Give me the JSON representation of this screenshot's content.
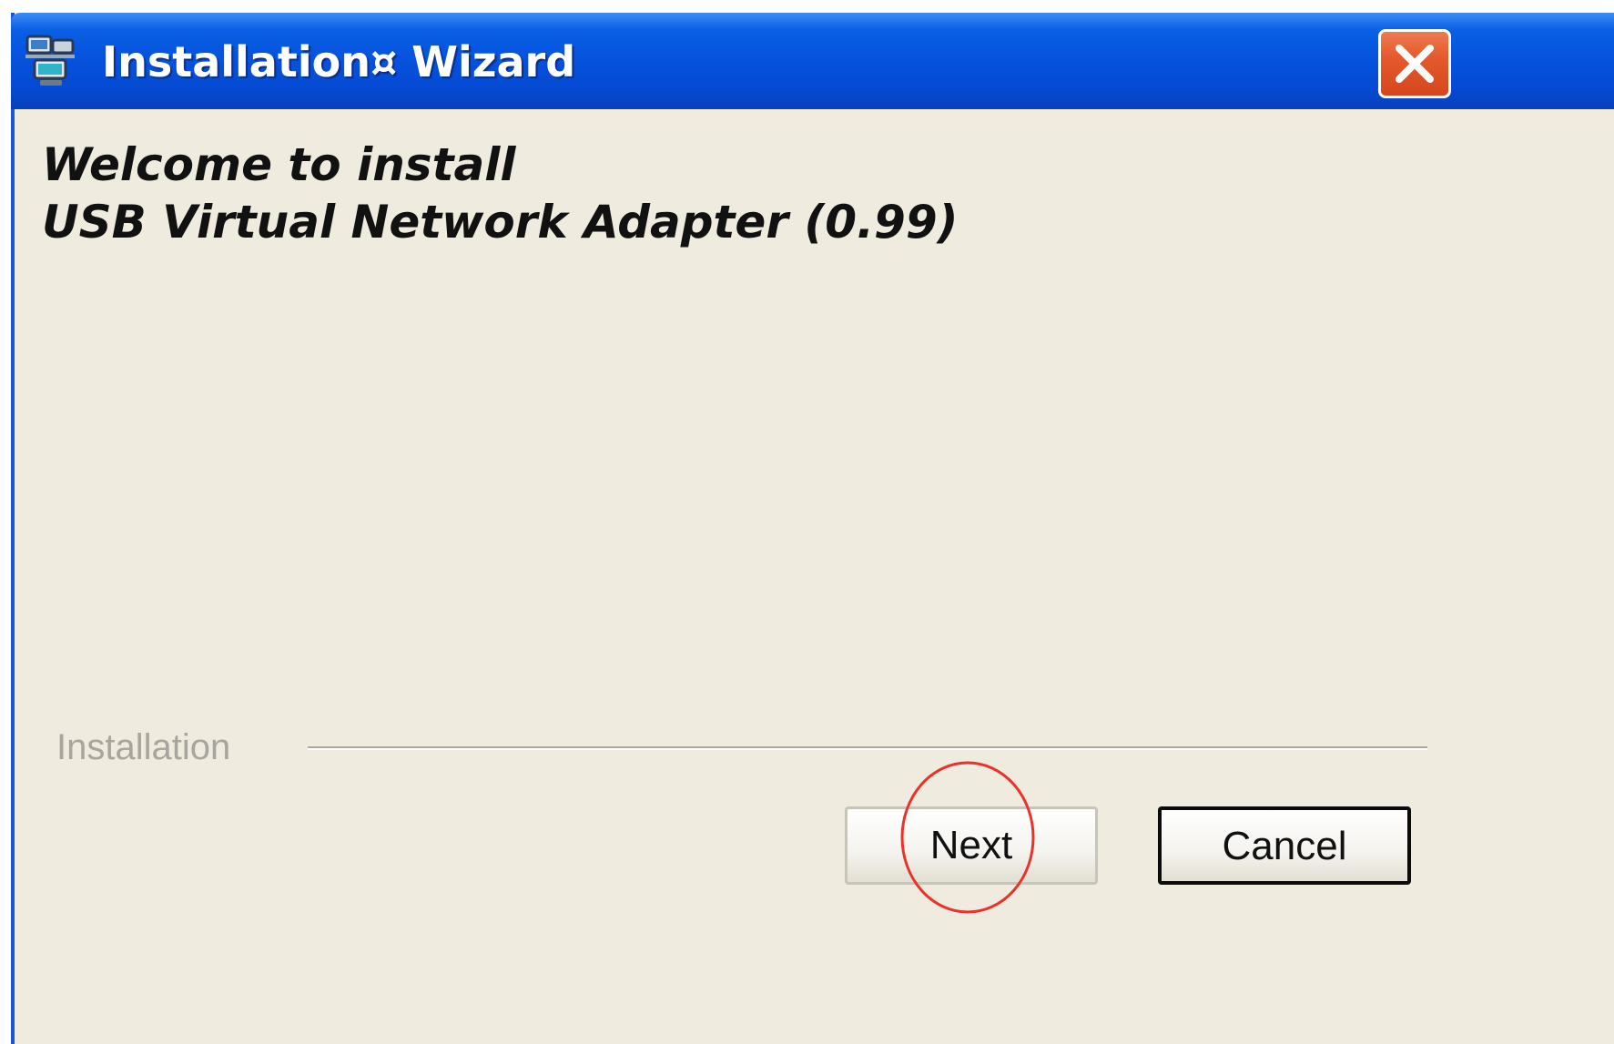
{
  "window": {
    "title": "Installation¤ Wizard"
  },
  "content": {
    "welcome_line": "Welcome to install",
    "product_line": "USB Virtual Network Adapter (0.99)"
  },
  "footer": {
    "group_label": "Installation",
    "next_label": "Next",
    "cancel_label": "Cancel"
  },
  "colors": {
    "titlebar": "#0552dd",
    "close_button": "#e45a2c",
    "dialog_background": "#efebdf",
    "annotation_circle": "#e8322a"
  },
  "icons": {
    "app": "network-computers-icon",
    "close": "close-icon"
  }
}
